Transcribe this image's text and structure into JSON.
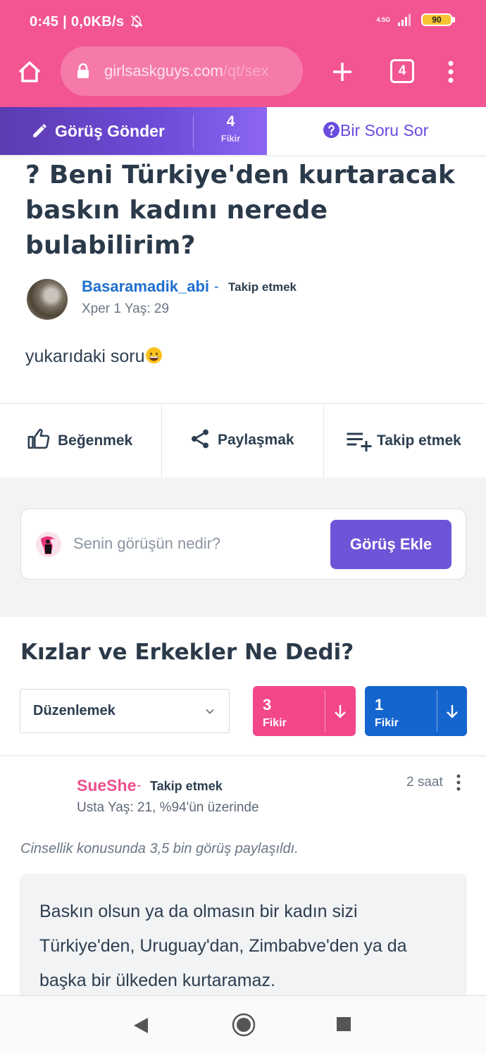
{
  "status_bar": {
    "time": "0:45 | 0,0KB/s",
    "network": "4.5G",
    "battery": "90"
  },
  "browser": {
    "url_main": "girlsaskguys.com",
    "url_path": "/qt/sex",
    "tab_count": "4"
  },
  "sticky_bar": {
    "send_opinion_label": "Görüş Gönder",
    "opinion_count": "4",
    "opinion_count_label": "Fikir",
    "ask_question_label": "Bir Soru Sor"
  },
  "question": {
    "title": "? Beni Türkiye'den kurtaracak baskın kadını nerede bulabilirim?",
    "author": "Basaramadik_abi",
    "author_dash": "-",
    "follow_label": "Takip etmek",
    "author_meta": "Xper 1  Yaş: 29",
    "body": "yukarıdaki soru"
  },
  "actions": {
    "like_label": "Beğenmek",
    "share_label": "Paylaşmak",
    "follow_label": "Takip etmek"
  },
  "opinion_box": {
    "placeholder": "Senin görüşün nedir?",
    "button_label": "Görüş Ekle"
  },
  "answers_section": {
    "title": "Kızlar ve Erkekler Ne Dedi?",
    "sort_label": "Düzenlemek",
    "girls_count": "3",
    "girls_label": "Fikir",
    "guys_count": "1",
    "guys_label": "Fikir"
  },
  "answer": {
    "author": "SueShe",
    "dash": "-",
    "follow_label": "Takip etmek",
    "time": "2 saat",
    "meta": "Usta Yaş: 21, %94'ün üzerinde",
    "stat": "Cinsellik konusunda 3,5 bin görüş paylaşıldı.",
    "text": "Baskın olsun ya da olmasın bir kadın sizi Türkiye'den, Uruguay'dan, Zimbabve'den ya da başka bir ülkeden kurtaramaz."
  },
  "colors": {
    "brand_pink": "#f25592",
    "purple": "#6e55d8",
    "girls_pink": "#f2478a",
    "guys_blue": "#1565cf"
  }
}
